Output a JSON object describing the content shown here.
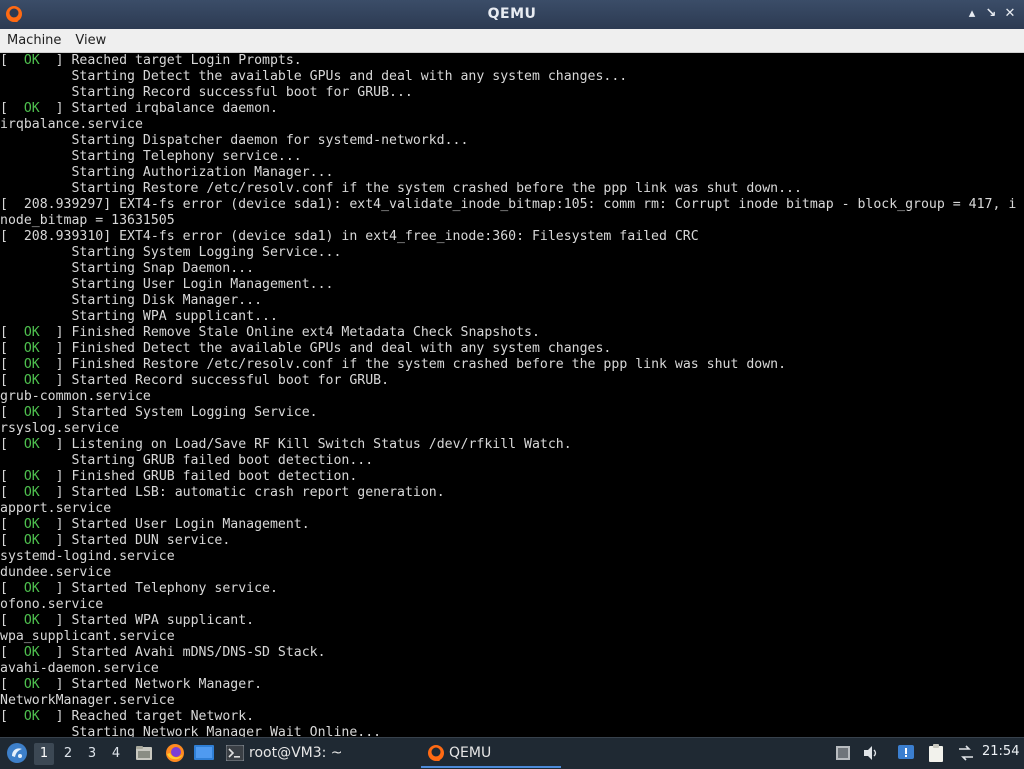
{
  "window": {
    "title": "QEMU",
    "controls": [
      "▴",
      "↘",
      "✕"
    ]
  },
  "menubar": {
    "items": [
      "Machine",
      "View"
    ]
  },
  "console": {
    "lines": [
      {
        "ok": true,
        "text": "Reached target Login Prompts."
      },
      {
        "ok": false,
        "text": "         Starting Detect the available GPUs and deal with any system changes..."
      },
      {
        "ok": false,
        "text": "         Starting Record successful boot for GRUB..."
      },
      {
        "ok": true,
        "text": "Started irqbalance daemon."
      },
      {
        "ok": false,
        "text": "irqbalance.service"
      },
      {
        "ok": false,
        "text": "         Starting Dispatcher daemon for systemd-networkd..."
      },
      {
        "ok": false,
        "text": "         Starting Telephony service..."
      },
      {
        "ok": false,
        "text": "         Starting Authorization Manager..."
      },
      {
        "ok": false,
        "text": "         Starting Restore /etc/resolv.conf if the system crashed before the ppp link was shut down..."
      },
      {
        "ok": false,
        "text": "[  208.939297] EXT4-fs error (device sda1): ext4_validate_inode_bitmap:105: comm rm: Corrupt inode bitmap - block_group = 417, i"
      },
      {
        "ok": false,
        "text": "node_bitmap = 13631505"
      },
      {
        "ok": false,
        "text": "[  208.939310] EXT4-fs error (device sda1) in ext4_free_inode:360: Filesystem failed CRC"
      },
      {
        "ok": false,
        "text": "         Starting System Logging Service..."
      },
      {
        "ok": false,
        "text": "         Starting Snap Daemon..."
      },
      {
        "ok": false,
        "text": "         Starting User Login Management..."
      },
      {
        "ok": false,
        "text": "         Starting Disk Manager..."
      },
      {
        "ok": false,
        "text": "         Starting WPA supplicant..."
      },
      {
        "ok": true,
        "text": "Finished Remove Stale Online ext4 Metadata Check Snapshots."
      },
      {
        "ok": true,
        "text": "Finished Detect the available GPUs and deal with any system changes."
      },
      {
        "ok": true,
        "text": "Finished Restore /etc/resolv.conf if the system crashed before the ppp link was shut down."
      },
      {
        "ok": true,
        "text": "Started Record successful boot for GRUB."
      },
      {
        "ok": false,
        "text": "grub-common.service"
      },
      {
        "ok": true,
        "text": "Started System Logging Service."
      },
      {
        "ok": false,
        "text": "rsyslog.service"
      },
      {
        "ok": true,
        "text": "Listening on Load/Save RF Kill Switch Status /dev/rfkill Watch."
      },
      {
        "ok": false,
        "text": "         Starting GRUB failed boot detection..."
      },
      {
        "ok": true,
        "text": "Finished GRUB failed boot detection."
      },
      {
        "ok": true,
        "text": "Started LSB: automatic crash report generation."
      },
      {
        "ok": false,
        "text": "apport.service"
      },
      {
        "ok": true,
        "text": "Started User Login Management."
      },
      {
        "ok": true,
        "text": "Started DUN service."
      },
      {
        "ok": false,
        "text": "systemd-logind.service"
      },
      {
        "ok": false,
        "text": "dundee.service"
      },
      {
        "ok": true,
        "text": "Started Telephony service."
      },
      {
        "ok": false,
        "text": "ofono.service"
      },
      {
        "ok": true,
        "text": "Started WPA supplicant."
      },
      {
        "ok": false,
        "text": "wpa_supplicant.service"
      },
      {
        "ok": true,
        "text": "Started Avahi mDNS/DNS-SD Stack."
      },
      {
        "ok": false,
        "text": "avahi-daemon.service"
      },
      {
        "ok": true,
        "text": "Started Network Manager."
      },
      {
        "ok": false,
        "text": "NetworkManager.service"
      },
      {
        "ok": true,
        "text": "Reached target Network."
      },
      {
        "ok": false,
        "text": "         Starting Network Manager Wait Online..."
      }
    ],
    "ok_prefix": "[  ",
    "ok_word": "OK",
    "ok_suffix": "  ] "
  },
  "taskbar": {
    "workspaces": [
      "1",
      "2",
      "3",
      "4"
    ],
    "active_workspace": 0,
    "tasks": [
      {
        "label": "root@VM3: ~",
        "icon": "terminal-icon"
      },
      {
        "label": "QEMU",
        "icon": "qemu-icon",
        "active": true
      }
    ],
    "clock": "21:54",
    "accent": "#4c8ad8"
  }
}
